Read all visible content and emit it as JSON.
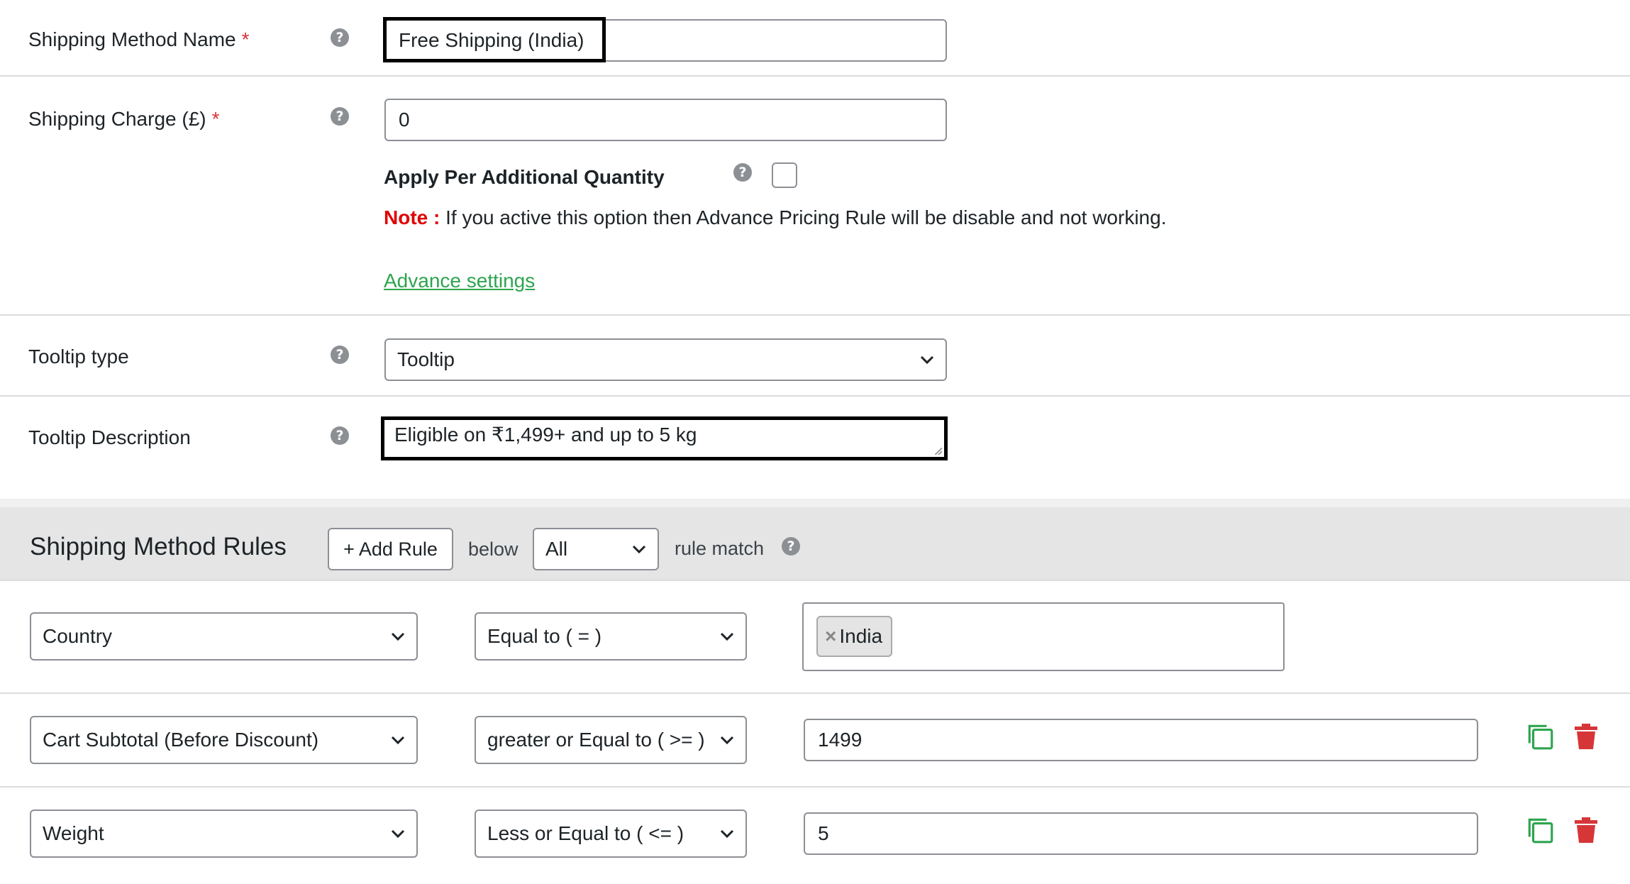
{
  "form": {
    "method_name": {
      "label": "Shipping Method Name",
      "required_mark": "*",
      "value": "Free Shipping (India)",
      "help": "?"
    },
    "charge": {
      "label": "Shipping Charge (£)",
      "required_mark": "*",
      "value": "0",
      "help": "?"
    },
    "per_qty": {
      "label": "Apply Per Additional Quantity",
      "help": "?"
    },
    "note": {
      "prefix": "Note :",
      "text": " If you active this option then Advance Pricing Rule will be disable and not working."
    },
    "advance_link": "Advance settings",
    "tooltip_type": {
      "label": "Tooltip type",
      "value": "Tooltip",
      "help": "?"
    },
    "tooltip_desc": {
      "label": "Tooltip Description",
      "value": "Eligible on ₹1,499+ and up to 5 kg",
      "help": "?"
    }
  },
  "rules": {
    "title": "Shipping Method Rules",
    "add_button": "+ Add Rule",
    "below": "below",
    "match_select": "All",
    "match_text": "rule match",
    "help": "?",
    "items": [
      {
        "field": "Country",
        "operator": "Equal to ( = )",
        "tag": "India",
        "tag_remove": "×"
      },
      {
        "field": "Cart Subtotal (Before Discount)",
        "operator": "greater or Equal to ( >= )",
        "value": "1499"
      },
      {
        "field": "Weight",
        "operator": "Less or Equal to ( <= )",
        "value": "5"
      }
    ]
  },
  "colors": {
    "required": "#d63638",
    "note": "#e00000",
    "link": "#2ea44f",
    "copy": "#2ea44f",
    "delete": "#d63638"
  }
}
